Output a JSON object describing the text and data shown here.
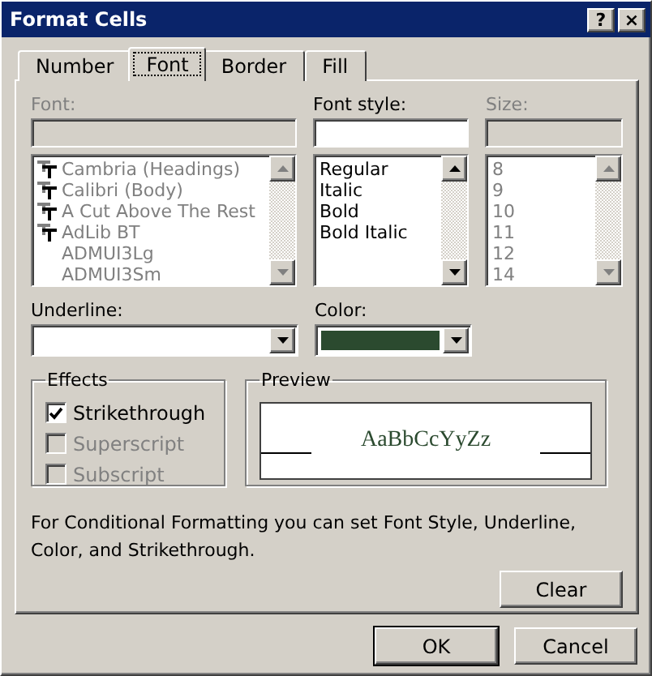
{
  "window": {
    "title": "Format Cells",
    "help": "?",
    "close": "×"
  },
  "tabs": [
    {
      "label": "Number",
      "selected": false
    },
    {
      "label": "Font",
      "selected": true
    },
    {
      "label": "Border",
      "selected": false
    },
    {
      "label": "Fill",
      "selected": false
    }
  ],
  "font": {
    "label": "Font:",
    "disabled": true,
    "items": [
      {
        "name": "Cambria (Headings)",
        "truetype": true
      },
      {
        "name": "Calibri (Body)",
        "truetype": true
      },
      {
        "name": "A Cut Above The Rest",
        "truetype": true
      },
      {
        "name": "AdLib BT",
        "truetype": true
      },
      {
        "name": "ADMUI3Lg",
        "truetype": false
      },
      {
        "name": "ADMUI3Sm",
        "truetype": false
      }
    ]
  },
  "font_style": {
    "label": "Font style:",
    "disabled": false,
    "items": [
      "Regular",
      "Italic",
      "Bold",
      "Bold Italic"
    ]
  },
  "size": {
    "label": "Size:",
    "disabled": true,
    "items": [
      "8",
      "9",
      "10",
      "11",
      "12",
      "14"
    ]
  },
  "underline": {
    "label": "Underline:"
  },
  "color": {
    "label": "Color:",
    "color": "#2b4a2f"
  },
  "effects": {
    "title": "Effects",
    "options": [
      {
        "label": "Strikethrough",
        "checked": true,
        "disabled": false
      },
      {
        "label": "Superscript",
        "checked": false,
        "disabled": true
      },
      {
        "label": "Subscript",
        "checked": false,
        "disabled": true
      }
    ]
  },
  "preview": {
    "title": "Preview",
    "sample": "AaBbCcYyZz"
  },
  "note": "For Conditional Formatting you can set Font Style, Underline, Color, and Strikethrough.",
  "clear_button": "Clear",
  "buttons": [
    {
      "label": "OK",
      "default": true
    },
    {
      "label": "Cancel",
      "default": false
    }
  ]
}
